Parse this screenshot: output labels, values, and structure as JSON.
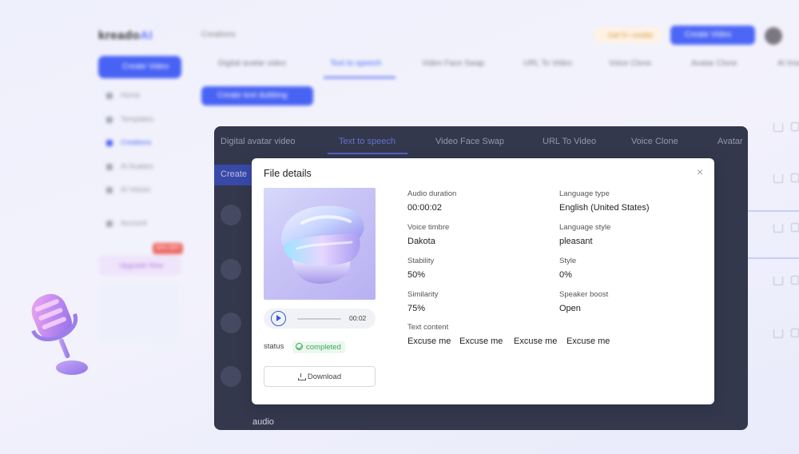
{
  "background_app": {
    "logo_text": "kreado",
    "logo_suffix": "AI",
    "breadcrumb": "Creations",
    "invite_label": "Get 5+ credits",
    "create_top_label": "Create Video",
    "sidebar": {
      "create_button": "Create Video",
      "items": [
        "Home",
        "Templates",
        "Creations",
        "AI Avatars",
        "AI Voices",
        "Account"
      ],
      "upgrade_label": "Upgrade Now",
      "hot_badge": "50% OFF"
    },
    "tabs": [
      "Digital avatar video",
      "Text to speech",
      "Video Face Swap",
      "URL To Video",
      "Voice Clone",
      "Avatar Clone",
      "AI Ima"
    ],
    "create_list_button": "Create text dubbing"
  },
  "overlay": {
    "tabs": [
      "Digital avatar video",
      "Text to speech",
      "Video Face Swap",
      "URL To Video",
      "Voice Clone",
      "Avatar"
    ],
    "create_label": "Create",
    "bottom_row_label": "audio"
  },
  "modal": {
    "title": "File details",
    "player": {
      "time": "00:02",
      "progress": 0
    },
    "status_label": "status",
    "status_value": "completed",
    "download_label": "Download",
    "fields": {
      "audio_duration": {
        "label": "Audio duration",
        "value": "00:00:02"
      },
      "language_type": {
        "label": "Language type",
        "value": "English (United States)"
      },
      "voice_timbre": {
        "label": "Voice timbre",
        "value": "Dakota"
      },
      "language_style": {
        "label": "Language style",
        "value": "pleasant"
      },
      "stability": {
        "label": "Stability",
        "value": "50%"
      },
      "style": {
        "label": "Style",
        "value": "0%"
      },
      "similarity": {
        "label": "Similarity",
        "value": "75%"
      },
      "speaker_boost": {
        "label": "Speaker boost",
        "value": "Open"
      }
    },
    "text_content_label": "Text content",
    "text_content": [
      "Excuse me",
      "Excuse me",
      "Excuse me",
      "Excuse me"
    ]
  },
  "colors": {
    "accent": "#3d58f5",
    "status_green": "#3aa658",
    "overlay_bg": "#24283e"
  }
}
